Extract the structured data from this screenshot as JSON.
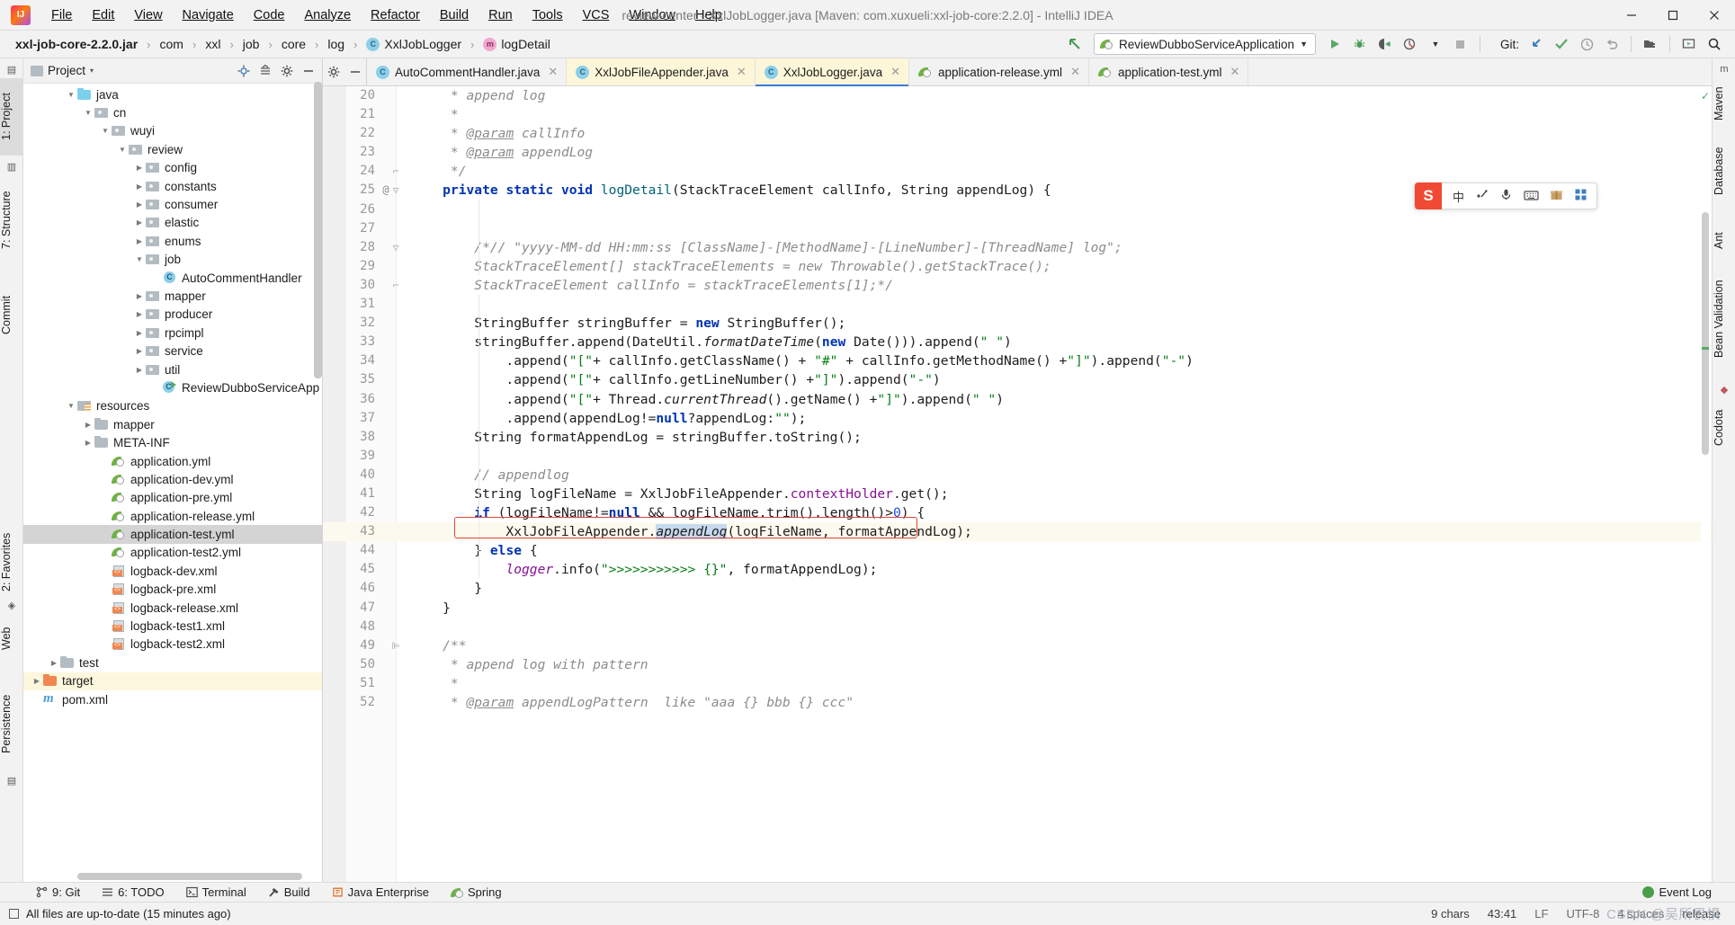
{
  "window": {
    "title": "review-center - XxlJobLogger.java [Maven: com.xuxueli:xxl-job-core:2.2.0] - IntelliJ IDEA",
    "minimize": "–",
    "maximize": "□",
    "close": "✕"
  },
  "menubar": [
    {
      "label": "File"
    },
    {
      "label": "Edit"
    },
    {
      "label": "View"
    },
    {
      "label": "Navigate"
    },
    {
      "label": "Code"
    },
    {
      "label": "Analyze"
    },
    {
      "label": "Refactor"
    },
    {
      "label": "Build"
    },
    {
      "label": "Run"
    },
    {
      "label": "Tools"
    },
    {
      "label": "VCS"
    },
    {
      "label": "Window"
    },
    {
      "label": "Help"
    }
  ],
  "navbar": {
    "breadcrumbs": [
      {
        "label": "xxl-job-core-2.2.0.jar",
        "icon": "",
        "bold": true
      },
      {
        "label": "com",
        "icon": ""
      },
      {
        "label": "xxl",
        "icon": ""
      },
      {
        "label": "job",
        "icon": ""
      },
      {
        "label": "core",
        "icon": ""
      },
      {
        "label": "log",
        "icon": ""
      },
      {
        "label": "XxlJobLogger",
        "icon": "class-badge"
      },
      {
        "label": "logDetail",
        "icon": "method-badge"
      }
    ],
    "separator": "›",
    "run_config": "ReviewDubboServiceApplication",
    "git_label": "Git:",
    "toolbar_icons": [
      "back-arrow-icon",
      "run-icon",
      "debug-icon",
      "run-with-coverage-icon",
      "profiler-icon",
      "stop-icon",
      "git-update-icon",
      "git-commit-icon",
      "git-history-icon",
      "git-rollback-icon",
      "open-file-icon",
      "preview-icon",
      "search-icon"
    ]
  },
  "left_strip": [
    {
      "label": "1: Project",
      "selected": true
    },
    {
      "label": "7: Structure",
      "selected": false
    },
    {
      "label": "Commit",
      "selected": false
    },
    {
      "label": "2: Favorites",
      "selected": false
    },
    {
      "label": "Web",
      "selected": false
    },
    {
      "label": "Persistence",
      "selected": false
    }
  ],
  "right_strip": [
    {
      "label": "Maven"
    },
    {
      "label": "Database"
    },
    {
      "label": "Ant"
    },
    {
      "label": "Bean Validation"
    },
    {
      "label": "Codota"
    }
  ],
  "project_panel": {
    "title": "Project",
    "chevron": "▾",
    "header_icons": [
      "locate-icon",
      "collapse-all-icon",
      "settings-icon",
      "hide-icon"
    ],
    "tree": [
      {
        "depth": 3,
        "arrow": "▼",
        "icon": "folder-blue",
        "label": "java",
        "state": "none"
      },
      {
        "depth": 4,
        "arrow": "▼",
        "icon": "folder-pkg",
        "label": "cn",
        "state": "none"
      },
      {
        "depth": 5,
        "arrow": "▼",
        "icon": "folder-pkg",
        "label": "wuyi",
        "state": "none"
      },
      {
        "depth": 6,
        "arrow": "▼",
        "icon": "folder-pkg",
        "label": "review",
        "state": "none"
      },
      {
        "depth": 7,
        "arrow": "▶",
        "icon": "folder-pkg",
        "label": "config",
        "state": "none"
      },
      {
        "depth": 7,
        "arrow": "▶",
        "icon": "folder-pkg",
        "label": "constants",
        "state": "none"
      },
      {
        "depth": 7,
        "arrow": "▶",
        "icon": "folder-pkg",
        "label": "consumer",
        "state": "none"
      },
      {
        "depth": 7,
        "arrow": "▶",
        "icon": "folder-pkg",
        "label": "elastic",
        "state": "none"
      },
      {
        "depth": 7,
        "arrow": "▶",
        "icon": "folder-pkg",
        "label": "enums",
        "state": "none"
      },
      {
        "depth": 7,
        "arrow": "▼",
        "icon": "folder-pkg",
        "label": "job",
        "state": "none"
      },
      {
        "depth": 8,
        "arrow": "",
        "icon": "java-class",
        "label": "AutoCommentHandler",
        "state": "none"
      },
      {
        "depth": 7,
        "arrow": "▶",
        "icon": "folder-pkg",
        "label": "mapper",
        "state": "none"
      },
      {
        "depth": 7,
        "arrow": "▶",
        "icon": "folder-pkg",
        "label": "producer",
        "state": "none"
      },
      {
        "depth": 7,
        "arrow": "▶",
        "icon": "folder-pkg",
        "label": "rpcimpl",
        "state": "none"
      },
      {
        "depth": 7,
        "arrow": "▶",
        "icon": "folder-pkg",
        "label": "service",
        "state": "none"
      },
      {
        "depth": 7,
        "arrow": "▶",
        "icon": "folder-pkg",
        "label": "util",
        "state": "none"
      },
      {
        "depth": 8,
        "arrow": "",
        "icon": "java-class-runnable",
        "label": "ReviewDubboServiceApp",
        "state": "none"
      },
      {
        "depth": 3,
        "arrow": "▼",
        "icon": "folder-resources",
        "label": "resources",
        "state": "none"
      },
      {
        "depth": 4,
        "arrow": "▶",
        "icon": "folder-gray",
        "label": "mapper",
        "state": "none"
      },
      {
        "depth": 4,
        "arrow": "▶",
        "icon": "folder-gray",
        "label": "META-INF",
        "state": "none"
      },
      {
        "depth": 5,
        "arrow": "",
        "icon": "yaml-file",
        "label": "application.yml",
        "state": "none"
      },
      {
        "depth": 5,
        "arrow": "",
        "icon": "yaml-file",
        "label": "application-dev.yml",
        "state": "none"
      },
      {
        "depth": 5,
        "arrow": "",
        "icon": "yaml-file",
        "label": "application-pre.yml",
        "state": "none"
      },
      {
        "depth": 5,
        "arrow": "",
        "icon": "yaml-file",
        "label": "application-release.yml",
        "state": "none"
      },
      {
        "depth": 5,
        "arrow": "",
        "icon": "yaml-file",
        "label": "application-test.yml",
        "state": "selected"
      },
      {
        "depth": 5,
        "arrow": "",
        "icon": "yaml-file",
        "label": "application-test2.yml",
        "state": "none"
      },
      {
        "depth": 5,
        "arrow": "",
        "icon": "xml-file",
        "label": "logback-dev.xml",
        "state": "none"
      },
      {
        "depth": 5,
        "arrow": "",
        "icon": "xml-file",
        "label": "logback-pre.xml",
        "state": "none"
      },
      {
        "depth": 5,
        "arrow": "",
        "icon": "xml-file",
        "label": "logback-release.xml",
        "state": "none"
      },
      {
        "depth": 5,
        "arrow": "",
        "icon": "xml-file",
        "label": "logback-test1.xml",
        "state": "none"
      },
      {
        "depth": 5,
        "arrow": "",
        "icon": "xml-file",
        "label": "logback-test2.xml",
        "state": "none"
      },
      {
        "depth": 2,
        "arrow": "▶",
        "icon": "folder-gray",
        "label": "test",
        "state": "none"
      },
      {
        "depth": 1,
        "arrow": "▶",
        "icon": "folder-orange",
        "label": "target",
        "state": "highlight"
      },
      {
        "depth": 1,
        "arrow": "",
        "icon": "maven-file",
        "label": "pom.xml",
        "state": "none"
      }
    ]
  },
  "editor_tabs": {
    "gear_icon": "gear-icon",
    "minimize_icon": "minimize-icon",
    "tabs": [
      {
        "label": "AutoCommentHandler.java",
        "icon": "class-badge",
        "style": "plain",
        "close": "✕"
      },
      {
        "label": "XxlJobFileAppender.java",
        "icon": "class-badge-locked",
        "style": "yellow",
        "close": "✕"
      },
      {
        "label": "XxlJobLogger.java",
        "icon": "class-badge-locked",
        "style": "active",
        "close": "✕"
      },
      {
        "label": "application-release.yml",
        "icon": "yaml-file",
        "style": "plain",
        "close": "✕"
      },
      {
        "label": "application-test.yml",
        "icon": "yaml-file",
        "style": "plain",
        "close": "✕"
      }
    ]
  },
  "code": {
    "first_line": 20,
    "lines": [
      {
        "n": 20,
        "annot": "",
        "fold": "",
        "html": "<span class='cmt'>     * append log</span>"
      },
      {
        "n": 21,
        "annot": "",
        "fold": "",
        "html": "<span class='cmt'>     *</span>"
      },
      {
        "n": 22,
        "annot": "",
        "fold": "",
        "html": "<span class='cmt'>     * <u>@param</u> callInfo</span>"
      },
      {
        "n": 23,
        "annot": "",
        "fold": "",
        "html": "<span class='cmt'>     * <u>@param</u> appendLog</span>"
      },
      {
        "n": 24,
        "annot": "",
        "fold": "⌐",
        "html": "<span class='cmt'>     */</span>"
      },
      {
        "n": 25,
        "annot": "@",
        "fold": "▽",
        "html": "    <span class='kw'>private static void </span><span class='mname'>logDetail</span>(StackTraceElement callInfo, String appendLog) {"
      },
      {
        "n": 26,
        "annot": "",
        "fold": "",
        "html": ""
      },
      {
        "n": 27,
        "annot": "",
        "fold": "",
        "html": ""
      },
      {
        "n": 28,
        "annot": "",
        "fold": "▽",
        "html": "<span class='cmt'>        /*// \"yyyy-MM-dd HH:mm:ss [ClassName]-[MethodName]-[LineNumber]-[ThreadName] log\";</span>"
      },
      {
        "n": 29,
        "annot": "",
        "fold": "",
        "html": "<span class='cmt'>        StackTraceElement[] stackTraceElements = new Throwable().getStackTrace();</span>"
      },
      {
        "n": 30,
        "annot": "",
        "fold": "⌐",
        "html": "<span class='cmt'>        StackTraceElement callInfo = stackTraceElements[1];*/</span>"
      },
      {
        "n": 31,
        "annot": "",
        "fold": "",
        "html": ""
      },
      {
        "n": 32,
        "annot": "",
        "fold": "",
        "html": "        StringBuffer stringBuffer = <span class='kw'>new </span>StringBuffer();"
      },
      {
        "n": 33,
        "annot": "",
        "fold": "",
        "html": "        stringBuffer.append(DateUtil.<span class='mth-it'>formatDateTime</span>(<span class='kw'>new </span>Date())).append(<span class='str'>\" \"</span>)"
      },
      {
        "n": 34,
        "annot": "",
        "fold": "",
        "html": "            .append(<span class='str'>\"[\"</span>+ callInfo.getClassName() + <span class='str'>\"#\"</span> + callInfo.getMethodName() +<span class='str'>\"]\"</span>).append(<span class='str'>\"-\"</span>)"
      },
      {
        "n": 35,
        "annot": "",
        "fold": "",
        "html": "            .append(<span class='str'>\"[\"</span>+ callInfo.getLineNumber() +<span class='str'>\"]\"</span>).append(<span class='str'>\"-\"</span>)"
      },
      {
        "n": 36,
        "annot": "",
        "fold": "",
        "html": "            .append(<span class='str'>\"[\"</span>+ Thread.<span class='mth-it'>currentThread</span>().getName() +<span class='str'>\"]\"</span>).append(<span class='str'>\" \"</span>)"
      },
      {
        "n": 37,
        "annot": "",
        "fold": "",
        "html": "            .append(appendLog!=<span class='kw'>null</span>?appendLog:<span class='str'>\"\"</span>);"
      },
      {
        "n": 38,
        "annot": "",
        "fold": "",
        "html": "        String formatAppendLog = stringBuffer.toString();"
      },
      {
        "n": 39,
        "annot": "",
        "fold": "",
        "html": ""
      },
      {
        "n": 40,
        "annot": "",
        "fold": "",
        "html": "        <span class='cmt'>// appendlog</span>"
      },
      {
        "n": 41,
        "annot": "",
        "fold": "",
        "html": "        String logFileName = XxlJobFileAppender.<span class='fld'>contextHolder</span>.get();"
      },
      {
        "n": 42,
        "annot": "",
        "fold": "",
        "html": "        <span class='kw'>if </span>(logFileName!=<span class='kw'>null</span> &amp;&amp; logFileName.trim().length()&gt;<span class='num'>0</span>) {"
      },
      {
        "n": 43,
        "annot": "",
        "fold": "",
        "html": "            XxlJobFileAppender.<span class='sel-token mth-it'>appendLog</span>(logFileName, formatAppendLog);"
      },
      {
        "n": 44,
        "annot": "",
        "fold": "",
        "html": "        } <span class='kw'>else </span>{"
      },
      {
        "n": 45,
        "annot": "",
        "fold": "",
        "html": "            <span class='fld'><i>logger</i></span>.info(<span class='str'>\"&gt;&gt;&gt;&gt;&gt;&gt;&gt;&gt;&gt;&gt;&gt; {}\"</span>, formatAppendLog);"
      },
      {
        "n": 46,
        "annot": "",
        "fold": "",
        "html": "        }"
      },
      {
        "n": 47,
        "annot": "",
        "fold": "",
        "html": "    }"
      },
      {
        "n": 48,
        "annot": "",
        "fold": "",
        "html": ""
      },
      {
        "n": 49,
        "annot": "",
        "fold": "⊫",
        "html": "<span class='cmt'>    /**</span>"
      },
      {
        "n": 50,
        "annot": "",
        "fold": "",
        "html": "<span class='cmt'>     * append log with pattern</span>"
      },
      {
        "n": 51,
        "annot": "",
        "fold": "",
        "html": "<span class='cmt'>     *</span>"
      },
      {
        "n": 52,
        "annot": "",
        "fold": "",
        "html": "<span class='cmt'>     * <u>@param</u> appendLogPattern  like \"aaa {} bbb {} ccc\"</span>"
      }
    ],
    "highlight_line": 43
  },
  "ime_widget": {
    "logo": "S",
    "items": [
      "中",
      "✎",
      "🎤",
      "⌨",
      "🎁",
      "⊞"
    ],
    "item_names": [
      "chinese-mode-icon",
      "handwriting-icon",
      "voice-input-icon",
      "keyboard-icon",
      "gift-icon",
      "apps-icon"
    ]
  },
  "bottom_bar": {
    "items": [
      {
        "label": "9: Git",
        "icon": "git-branch-icon",
        "underline": "9"
      },
      {
        "label": "6: TODO",
        "icon": "todo-list-icon",
        "underline": "6"
      },
      {
        "label": "Terminal",
        "icon": "terminal-icon",
        "underline": ""
      },
      {
        "label": "Build",
        "icon": "hammer-icon",
        "underline": ""
      },
      {
        "label": "Java Enterprise",
        "icon": "java-enterprise-icon",
        "underline": ""
      },
      {
        "label": "Spring",
        "icon": "spring-leaf-icon",
        "underline": ""
      }
    ],
    "event_log": "Event Log"
  },
  "status_bar": {
    "message": "All files are up-to-date (15 minutes ago)",
    "chars": "9 chars",
    "caret": "43:41",
    "line_separator": "LF",
    "encoding": "UTF-8",
    "indent": "4 spaces",
    "branch": "release",
    "watermark": "CSDN @吴所畏惧"
  }
}
